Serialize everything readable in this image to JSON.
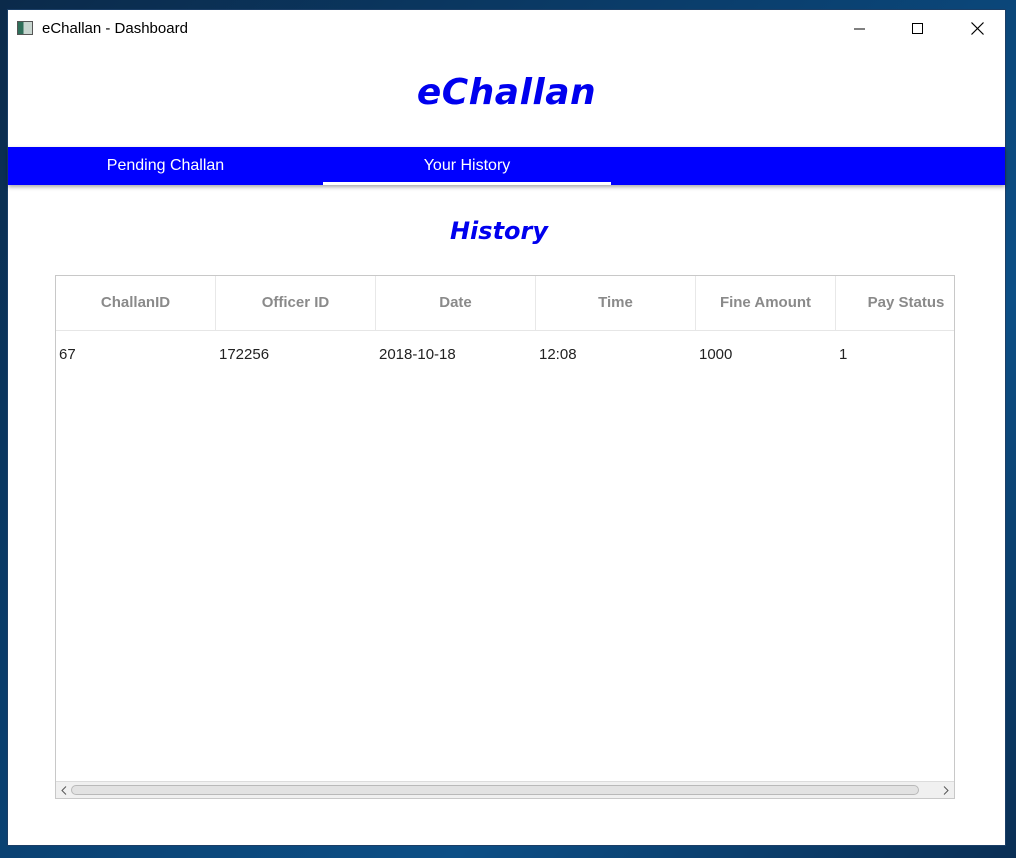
{
  "window": {
    "title": "eChallan - Dashboard"
  },
  "app": {
    "heading": "eChallan"
  },
  "tabs": [
    {
      "label": "Pending Challan",
      "selected": false
    },
    {
      "label": "Your History",
      "selected": true
    }
  ],
  "history": {
    "title": "History",
    "columns": [
      "ChallanID",
      "Officer ID",
      "Date",
      "Time",
      "Fine Amount",
      "Pay Status"
    ],
    "rows": [
      [
        "67",
        "172256",
        "2018-10-18",
        "12:08",
        "1000",
        "1"
      ]
    ]
  },
  "colors": {
    "accent": "#0000ff",
    "heading": "#0000ee",
    "header_text": "#8a8a8a"
  },
  "icons": {
    "app": "app-window-icon",
    "minimize": "minimize-icon",
    "maximize": "maximize-icon",
    "close": "close-icon"
  }
}
